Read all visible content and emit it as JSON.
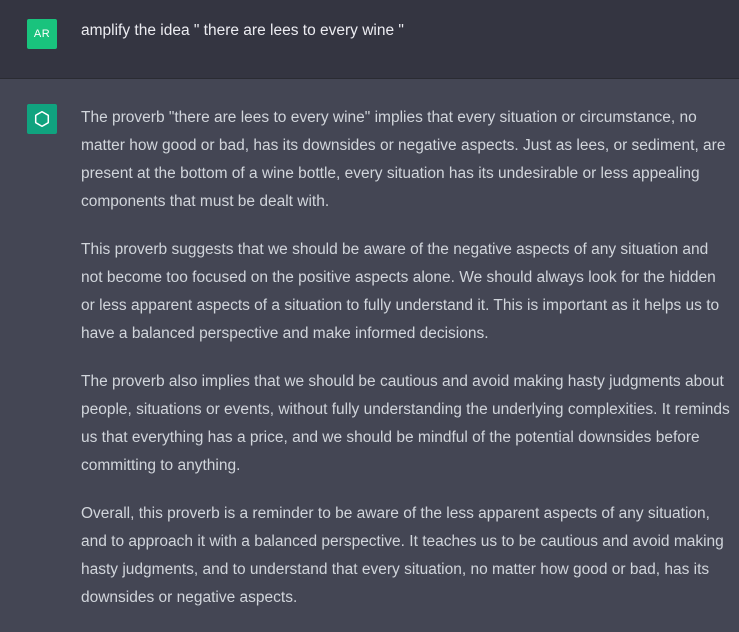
{
  "user": {
    "avatar_initials": "AR",
    "message": "amplify the idea \" there are lees to every wine \""
  },
  "assistant": {
    "avatar_icon": "openai-logo-icon",
    "paragraphs": [
      "The proverb \"there are lees to every wine\" implies that every situation or circumstance, no matter how good or bad, has its downsides or negative aspects. Just as lees, or sediment, are present at the bottom of a wine bottle, every situation has its undesirable or less appealing components that must be dealt with.",
      "This proverb suggests that we should be aware of the negative aspects of any situation and not become too focused on the positive aspects alone. We should always look for the hidden or less apparent aspects of a situation to fully understand it. This is important as it helps us to have a balanced perspective and make informed decisions.",
      "The proverb also implies that we should be cautious and avoid making hasty judgments about people, situations or events, without fully understanding the underlying complexities. It reminds us that everything has a price, and we should be mindful of the potential downsides before committing to anything.",
      "Overall, this proverb is a reminder to be aware of the less apparent aspects of any situation, and to approach it with a balanced perspective. It teaches us to be cautious and avoid making hasty judgments, and to understand that every situation, no matter how good or bad, has its downsides or negative aspects."
    ]
  },
  "colors": {
    "user_bg": "#343541",
    "assistant_bg": "#444654",
    "user_avatar": "#19c37d",
    "bot_avatar": "#10a37f"
  }
}
